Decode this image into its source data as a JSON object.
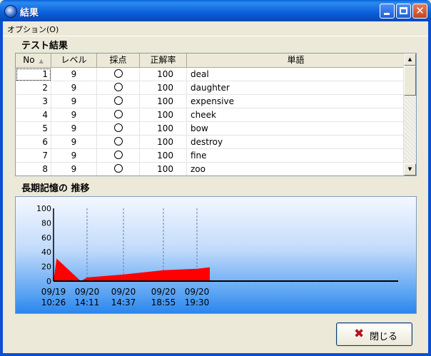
{
  "window": {
    "title": "結果"
  },
  "menu": {
    "options_label": "オプション(O)"
  },
  "test_section": {
    "label": "テスト結果",
    "columns": [
      "No",
      "レベル",
      "採点",
      "正解率",
      "単語"
    ],
    "rows": [
      {
        "no": "1",
        "level": "9",
        "score": "○",
        "rate": "100",
        "word": "deal"
      },
      {
        "no": "2",
        "level": "9",
        "score": "○",
        "rate": "100",
        "word": "daughter"
      },
      {
        "no": "3",
        "level": "9",
        "score": "○",
        "rate": "100",
        "word": "expensive"
      },
      {
        "no": "4",
        "level": "9",
        "score": "○",
        "rate": "100",
        "word": "cheek"
      },
      {
        "no": "5",
        "level": "9",
        "score": "○",
        "rate": "100",
        "word": "bow"
      },
      {
        "no": "6",
        "level": "9",
        "score": "○",
        "rate": "100",
        "word": "destroy"
      },
      {
        "no": "7",
        "level": "9",
        "score": "○",
        "rate": "100",
        "word": "fine"
      },
      {
        "no": "8",
        "level": "9",
        "score": "○",
        "rate": "100",
        "word": "zoo"
      }
    ]
  },
  "memory_section": {
    "label": "長期記憶の 推移"
  },
  "chart_data": {
    "type": "area",
    "title": "",
    "xlabel": "",
    "ylabel": "",
    "ylim": [
      0,
      100
    ],
    "y_ticks": [
      "100",
      "80",
      "60",
      "40",
      "20",
      "0"
    ],
    "x_labels": [
      {
        "date": "09/19",
        "time": "10:26"
      },
      {
        "date": "09/20",
        "time": "14:11"
      },
      {
        "date": "09/20",
        "time": "14:37"
      },
      {
        "date": "09/20",
        "time": "18:55"
      },
      {
        "date": "09/20",
        "time": "19:30"
      }
    ],
    "series": [
      {
        "points": [
          {
            "x": "09/19 10:26",
            "y": 0
          },
          {
            "x": "09/19 13:00",
            "y": 31
          },
          {
            "x": "09/20 09:00",
            "y": 0
          },
          {
            "x": "09/20 14:11",
            "y": 5
          },
          {
            "x": "09/20 14:37",
            "y": 9
          },
          {
            "x": "09/20 18:55",
            "y": 15
          },
          {
            "x": "09/20 19:30",
            "y": 17
          },
          {
            "x": "09/20 20:00",
            "y": 19
          }
        ]
      }
    ],
    "grid": "dashed vertical lines at review times",
    "fill_color": "#ff0000"
  },
  "buttons": {
    "close_label": "閉じる"
  },
  "colors": {
    "titlebar": "#0a5fd8",
    "chart_fill": "#ff0000",
    "chart_bg_bottom": "#2a86ee"
  }
}
